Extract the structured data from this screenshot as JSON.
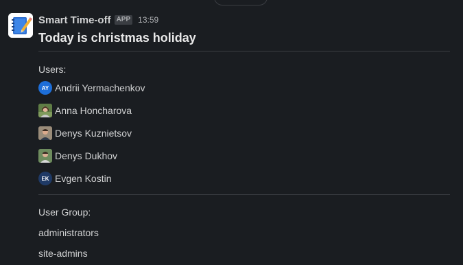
{
  "message": {
    "app_name": "Smart Time-off",
    "app_badge": "APP",
    "time": "13:59",
    "title": "Today is christmas holiday"
  },
  "users_section": {
    "label": "Users:",
    "users": [
      {
        "name": "Andrii Yermachenkov",
        "initials": "AY",
        "avatar_type": "initials",
        "avatar_color": "#1d6ed8"
      },
      {
        "name": "Anna Honcharova",
        "initials": "",
        "avatar_type": "photo",
        "avatar_color": "#6b8a4e"
      },
      {
        "name": "Denys Kuznietsov",
        "initials": "",
        "avatar_type": "photo",
        "avatar_color": "#8a7a66"
      },
      {
        "name": "Denys Dukhov",
        "initials": "",
        "avatar_type": "photo",
        "avatar_color": "#5d7a52"
      },
      {
        "name": "Evgen Kostin",
        "initials": "EK",
        "avatar_type": "initials",
        "avatar_color": "#1f3a66"
      }
    ]
  },
  "groups_section": {
    "label": "User Group:",
    "groups": [
      "administrators",
      "site-admins"
    ]
  },
  "icons": {
    "app_icon": "notebook-pencil-icon"
  }
}
